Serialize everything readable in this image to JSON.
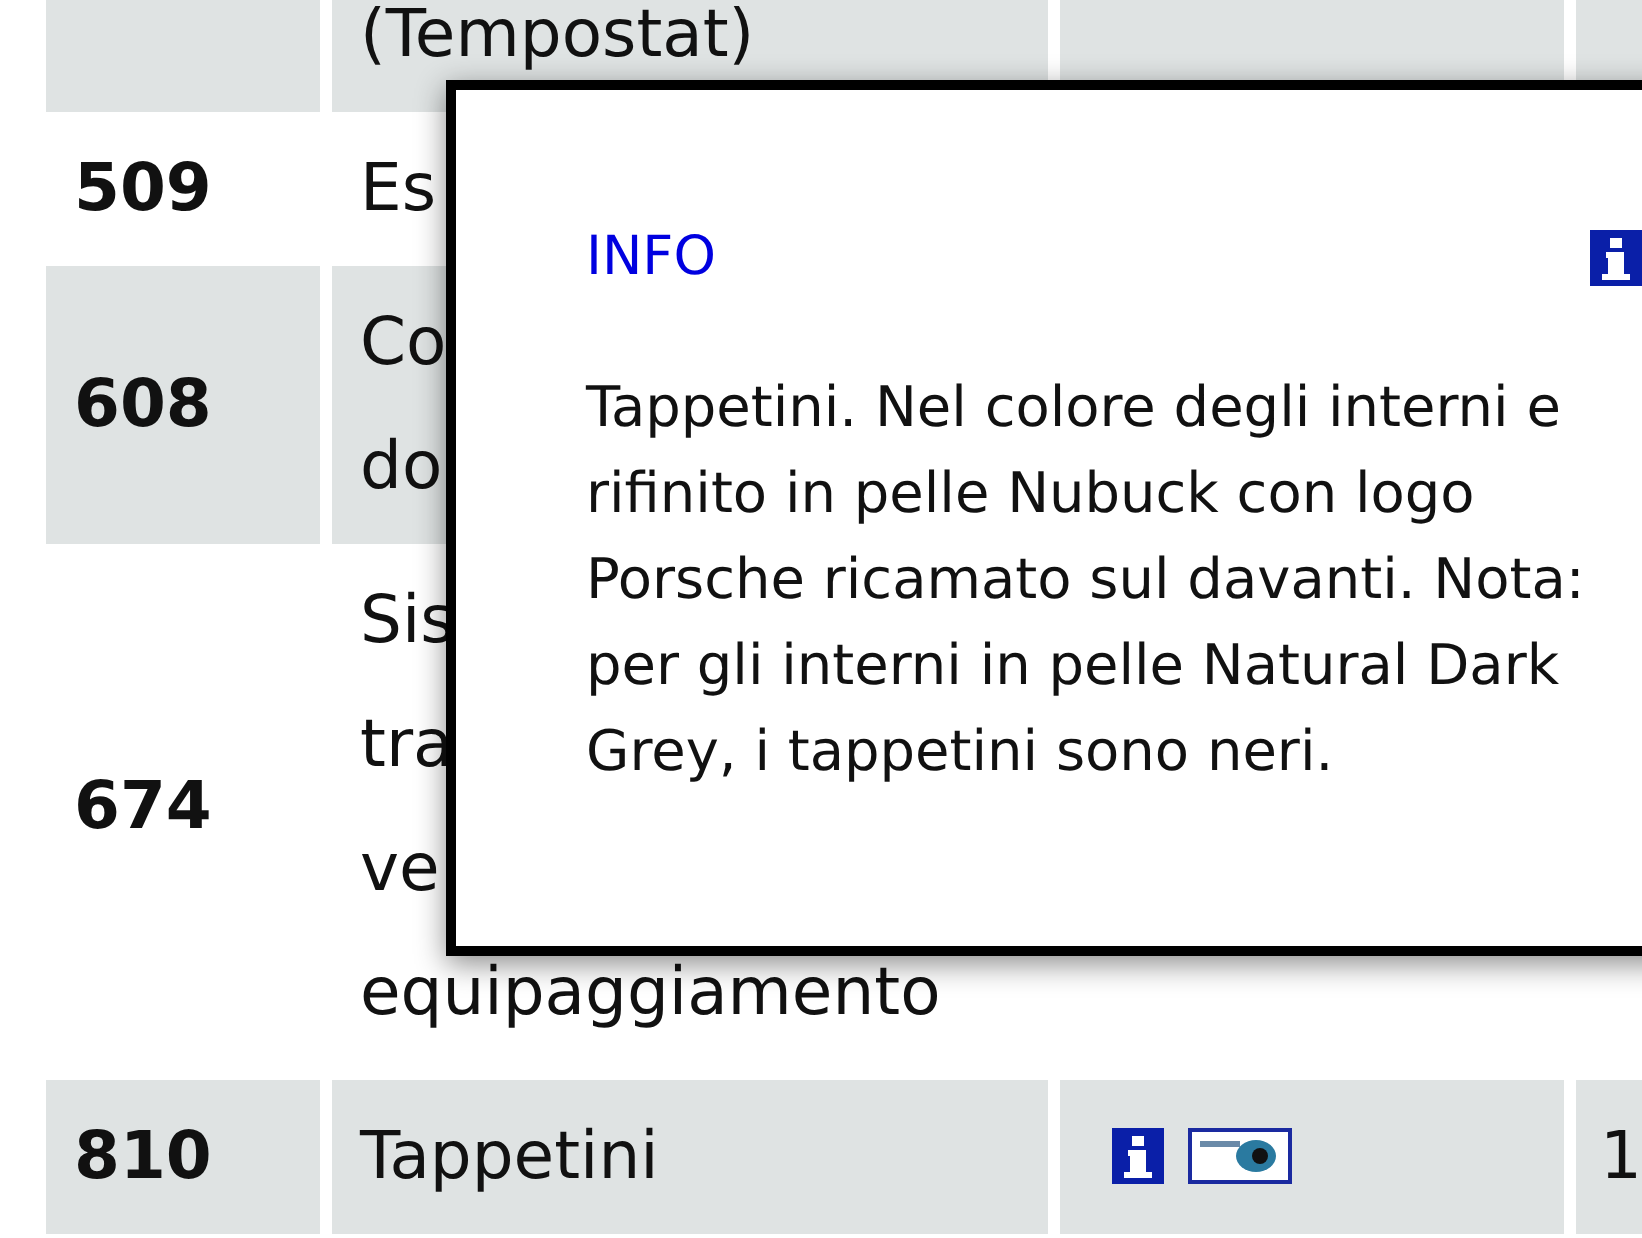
{
  "table": {
    "rows": [
      {
        "description_lines": [
          "(Tempostat)"
        ],
        "icons_shown": false
      },
      {
        "code": "509",
        "description_lines": [
          "Es"
        ]
      },
      {
        "code": "608",
        "description_lines": [
          "Co",
          "do"
        ]
      },
      {
        "code": "674",
        "description_lines": [
          "Sis",
          "tra",
          "ve",
          "equipaggiamento"
        ]
      },
      {
        "code": "810",
        "description_lines": [
          "Tappetini"
        ],
        "icons_shown": true,
        "column_4": "1"
      }
    ]
  },
  "popup": {
    "title": "INFO",
    "text": "Tappetini. Nel colore degli interni e rifinito in pelle Nubuck con logo Porsche ricamato sul davanti. Nota: per gli interni in pelle Natural Dark Grey, i tappetini sono neri."
  }
}
